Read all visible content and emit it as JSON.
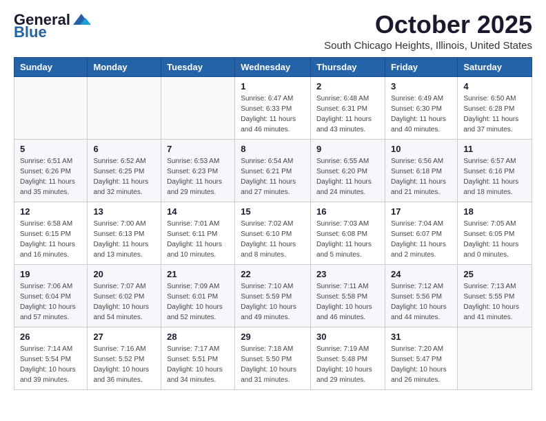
{
  "header": {
    "logo_general": "General",
    "logo_blue": "Blue",
    "month_title": "October 2025",
    "location": "South Chicago Heights, Illinois, United States"
  },
  "calendar": {
    "days_of_week": [
      "Sunday",
      "Monday",
      "Tuesday",
      "Wednesday",
      "Thursday",
      "Friday",
      "Saturday"
    ],
    "weeks": [
      [
        {
          "day": "",
          "info": ""
        },
        {
          "day": "",
          "info": ""
        },
        {
          "day": "",
          "info": ""
        },
        {
          "day": "1",
          "info": "Sunrise: 6:47 AM\nSunset: 6:33 PM\nDaylight: 11 hours\nand 46 minutes."
        },
        {
          "day": "2",
          "info": "Sunrise: 6:48 AM\nSunset: 6:31 PM\nDaylight: 11 hours\nand 43 minutes."
        },
        {
          "day": "3",
          "info": "Sunrise: 6:49 AM\nSunset: 6:30 PM\nDaylight: 11 hours\nand 40 minutes."
        },
        {
          "day": "4",
          "info": "Sunrise: 6:50 AM\nSunset: 6:28 PM\nDaylight: 11 hours\nand 37 minutes."
        }
      ],
      [
        {
          "day": "5",
          "info": "Sunrise: 6:51 AM\nSunset: 6:26 PM\nDaylight: 11 hours\nand 35 minutes."
        },
        {
          "day": "6",
          "info": "Sunrise: 6:52 AM\nSunset: 6:25 PM\nDaylight: 11 hours\nand 32 minutes."
        },
        {
          "day": "7",
          "info": "Sunrise: 6:53 AM\nSunset: 6:23 PM\nDaylight: 11 hours\nand 29 minutes."
        },
        {
          "day": "8",
          "info": "Sunrise: 6:54 AM\nSunset: 6:21 PM\nDaylight: 11 hours\nand 27 minutes."
        },
        {
          "day": "9",
          "info": "Sunrise: 6:55 AM\nSunset: 6:20 PM\nDaylight: 11 hours\nand 24 minutes."
        },
        {
          "day": "10",
          "info": "Sunrise: 6:56 AM\nSunset: 6:18 PM\nDaylight: 11 hours\nand 21 minutes."
        },
        {
          "day": "11",
          "info": "Sunrise: 6:57 AM\nSunset: 6:16 PM\nDaylight: 11 hours\nand 18 minutes."
        }
      ],
      [
        {
          "day": "12",
          "info": "Sunrise: 6:58 AM\nSunset: 6:15 PM\nDaylight: 11 hours\nand 16 minutes."
        },
        {
          "day": "13",
          "info": "Sunrise: 7:00 AM\nSunset: 6:13 PM\nDaylight: 11 hours\nand 13 minutes."
        },
        {
          "day": "14",
          "info": "Sunrise: 7:01 AM\nSunset: 6:11 PM\nDaylight: 11 hours\nand 10 minutes."
        },
        {
          "day": "15",
          "info": "Sunrise: 7:02 AM\nSunset: 6:10 PM\nDaylight: 11 hours\nand 8 minutes."
        },
        {
          "day": "16",
          "info": "Sunrise: 7:03 AM\nSunset: 6:08 PM\nDaylight: 11 hours\nand 5 minutes."
        },
        {
          "day": "17",
          "info": "Sunrise: 7:04 AM\nSunset: 6:07 PM\nDaylight: 11 hours\nand 2 minutes."
        },
        {
          "day": "18",
          "info": "Sunrise: 7:05 AM\nSunset: 6:05 PM\nDaylight: 11 hours\nand 0 minutes."
        }
      ],
      [
        {
          "day": "19",
          "info": "Sunrise: 7:06 AM\nSunset: 6:04 PM\nDaylight: 10 hours\nand 57 minutes."
        },
        {
          "day": "20",
          "info": "Sunrise: 7:07 AM\nSunset: 6:02 PM\nDaylight: 10 hours\nand 54 minutes."
        },
        {
          "day": "21",
          "info": "Sunrise: 7:09 AM\nSunset: 6:01 PM\nDaylight: 10 hours\nand 52 minutes."
        },
        {
          "day": "22",
          "info": "Sunrise: 7:10 AM\nSunset: 5:59 PM\nDaylight: 10 hours\nand 49 minutes."
        },
        {
          "day": "23",
          "info": "Sunrise: 7:11 AM\nSunset: 5:58 PM\nDaylight: 10 hours\nand 46 minutes."
        },
        {
          "day": "24",
          "info": "Sunrise: 7:12 AM\nSunset: 5:56 PM\nDaylight: 10 hours\nand 44 minutes."
        },
        {
          "day": "25",
          "info": "Sunrise: 7:13 AM\nSunset: 5:55 PM\nDaylight: 10 hours\nand 41 minutes."
        }
      ],
      [
        {
          "day": "26",
          "info": "Sunrise: 7:14 AM\nSunset: 5:54 PM\nDaylight: 10 hours\nand 39 minutes."
        },
        {
          "day": "27",
          "info": "Sunrise: 7:16 AM\nSunset: 5:52 PM\nDaylight: 10 hours\nand 36 minutes."
        },
        {
          "day": "28",
          "info": "Sunrise: 7:17 AM\nSunset: 5:51 PM\nDaylight: 10 hours\nand 34 minutes."
        },
        {
          "day": "29",
          "info": "Sunrise: 7:18 AM\nSunset: 5:50 PM\nDaylight: 10 hours\nand 31 minutes."
        },
        {
          "day": "30",
          "info": "Sunrise: 7:19 AM\nSunset: 5:48 PM\nDaylight: 10 hours\nand 29 minutes."
        },
        {
          "day": "31",
          "info": "Sunrise: 7:20 AM\nSunset: 5:47 PM\nDaylight: 10 hours\nand 26 minutes."
        },
        {
          "day": "",
          "info": ""
        }
      ]
    ]
  }
}
